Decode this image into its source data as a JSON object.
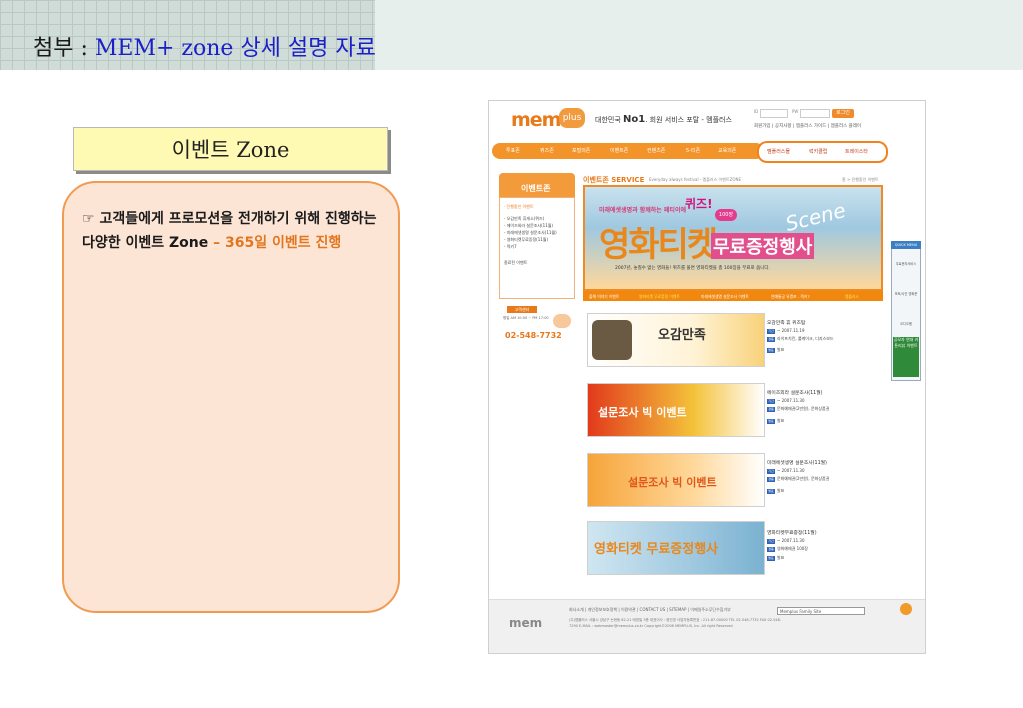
{
  "slide": {
    "title_main": "첨부 : ",
    "title_sub": "MEM+ zone 상세 설명 자료"
  },
  "zone_label": "이벤트 Zone",
  "description": {
    "bullet": "☞",
    "text": "고객들에게 프로모션을 전개하기 위해 진행하는 다양한 이벤트 Zone",
    "highlight": " – 365일 이벤트 진행"
  },
  "website": {
    "logo": "mem",
    "logo_badge": "plus",
    "tagline_prefix": "대한민국 ",
    "tagline_no1": "No1",
    "tagline_suffix": ". 회원 서비스 포탈 - 멤플러스",
    "login_id_label": "ID",
    "login_pw_label": "PW",
    "login_button": "로그인",
    "util_links": "회원가입 | 공지사항 | 멤플러스 가이드 | 멤플러스 플레이",
    "nav": [
      "투표존",
      "퀴즈존",
      "포털의존",
      "이벤트존",
      "컨텐츠존",
      "5-티존",
      "교육의존"
    ],
    "nav_right": [
      "멤플러스몰",
      "럭키클럽",
      "트레이스타"
    ],
    "sidebar": {
      "title": "이벤트존",
      "items": [
        "· 진행중인 이벤트",
        "- 오감만족 휴게소(퀴즈)",
        "- 에이즈외라 설문조사(11월)",
        "- 미래에셋생명 설문조사(11월)",
        "- 영화티켓무료증정(11월)",
        "- 럭키7",
        "종료된 이벤트"
      ],
      "cc_label": "고객센터",
      "cc_hours": "평일 AM 10:00 ~ PM 17:00",
      "cc_phone": "02-548-7732"
    },
    "service_title": "이벤트존 SERVICE",
    "service_sub": "Everyday always festival - 멤플러스 이벤트ZONE",
    "breadcrumb": "홈 > 진행중인 이벤트",
    "banner": {
      "top": "미래에셋생명과 함께하는 패티이에",
      "quiz": "퀴즈!",
      "badge": "100장",
      "main": "영화티켓",
      "main2": "무료증정행사",
      "script": "Scene",
      "note": "2007년, 놓칠수 없는 영화들! 퀴즈를 풀면 영화티켓을 총 100장을 무료로 쏩니다."
    },
    "banner_tabs": [
      "올해 이야기 이벤트",
      "영화티켓 무료증정 이벤트",
      "미래에셋생명 설문조사 이벤트",
      "연예통공 유명포 - 럭키7",
      "멤플러스"
    ],
    "events": [
      {
        "big": "오감만족",
        "title": "오감만족 휴 퀴즈탐",
        "date": "~ 2007.11.19",
        "prize": "라이프치킨, 롤케이크, 디지스보드",
        "result": "발표"
      },
      {
        "big": "설문조사 빅 이벤트",
        "title": "에이즈외라 설문조사(11월)",
        "date": "~ 2007.11.30",
        "prize": "문화예매권(2만원), 문화상품권",
        "result": "발표"
      },
      {
        "big": "설문조사 빅 이벤트",
        "title": "미래에셋생명 설문조사(11월)",
        "date": "~ 2007.11.30",
        "prize": "문화예매권(2만원), 문화상품권",
        "result": "발표"
      },
      {
        "big": "영화티켓 무료증정행사",
        "title": "영화티켓무료증정(11월)",
        "date": "~ 2007.11.30",
        "prize": "영화예매권 100장",
        "result": "발표"
      }
    ],
    "event_tags": {
      "date": "기간",
      "prize": "경품",
      "result": "발표"
    },
    "quick_menu": {
      "head": "QUICK MENU",
      "items": [
        "무료문자서비스",
        "포토/사진 영화운",
        "오디오뱅"
      ],
      "ad": "공모자 연대 카툰리뷰 이벤트"
    },
    "footer": {
      "logo": "mem",
      "links": "회사소개 | 개인정보보호정책 | 이용약관 | CONTACT US | SITEMAP | 이메일주소무단수집거부",
      "address": "(주)멤플러스 서울시 강남구 논현동 82-21 태영빌 3층 대표이사 : 정인영 사업자등록번호 : 211-87-00000 TEL 02-548-7732 FAX 02-548-7290 E-MAIL : webmaster@memplus.co.kr Copyright©2006 MEMPLUS, Inc. All right Reserved",
      "family_site": "Memplus Family Site"
    }
  },
  "colors": {
    "accent": "#f0922a",
    "title_blue": "#1a1fc8",
    "box_fill": "#fde5d6",
    "label_fill": "#fffab3"
  }
}
